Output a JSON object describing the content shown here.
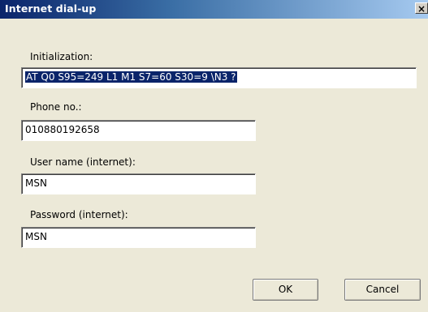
{
  "window": {
    "title": "Internet dial-up",
    "close_glyph": "×"
  },
  "fields": {
    "initialization": {
      "label": "Initialization:",
      "value": "AT Q0 S95=249 L1 M1 S7=60 S30=9 \\N3 ?"
    },
    "phone": {
      "label": "Phone no.:",
      "value": "010880192658"
    },
    "username": {
      "label": "User name (internet):",
      "value": "MSN"
    },
    "password": {
      "label": "Password (internet):",
      "value": "MSN"
    }
  },
  "buttons": {
    "ok": "OK",
    "cancel": "Cancel"
  },
  "colors": {
    "title_gradient_start": "#0a246a",
    "title_gradient_end": "#a6caf0",
    "selection": "#0a246a",
    "dialog_bg": "#ece9d8"
  }
}
